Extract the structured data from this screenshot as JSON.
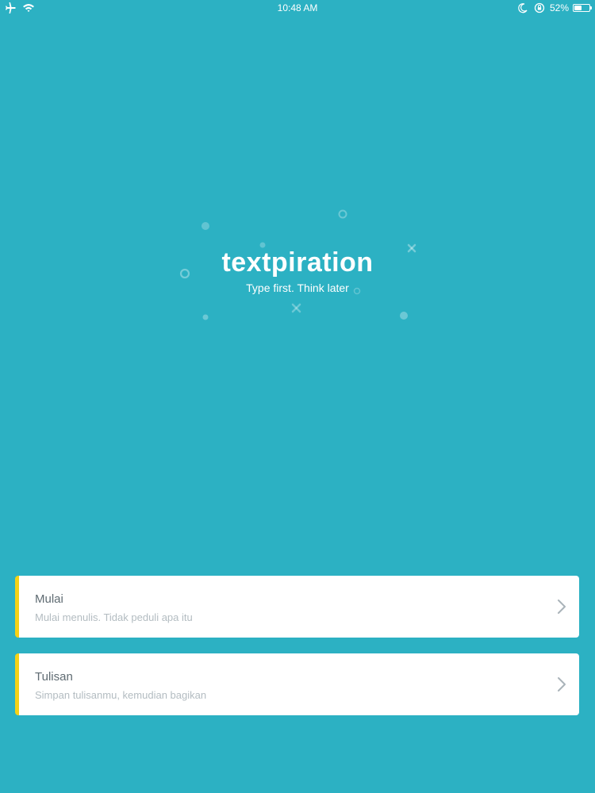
{
  "status_bar": {
    "time": "10:48 AM",
    "battery_percent": "52%",
    "battery_level": 0.52,
    "icons": [
      "airplane-icon",
      "wifi-icon",
      "moon-icon",
      "orientation-lock-icon",
      "battery-icon"
    ]
  },
  "logo": {
    "title": "textpiration",
    "tagline": "Type first. Think later"
  },
  "menu": {
    "items": [
      {
        "title": "Mulai",
        "subtitle": "Mulai menulis. Tidak peduli apa itu"
      },
      {
        "title": "Tulisan",
        "subtitle": "Simpan tulisanmu, kemudian bagikan"
      }
    ]
  },
  "colors": {
    "background": "#2cb1c3",
    "card_accent": "#f5d215",
    "card_background": "#ffffff",
    "card_title": "#5f6b72",
    "card_subtitle": "#b3bcc1"
  }
}
